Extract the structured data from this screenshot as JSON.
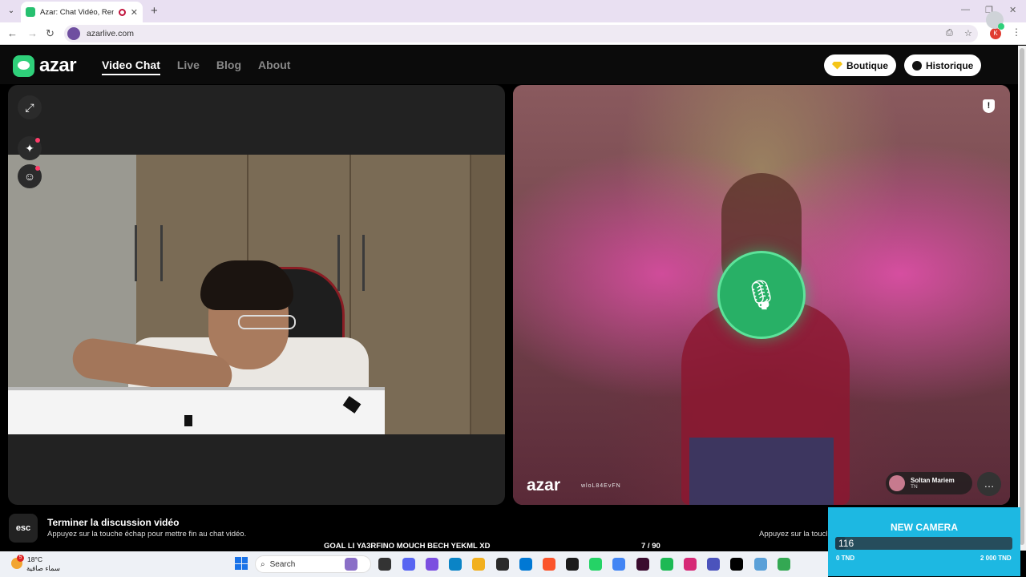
{
  "browser": {
    "tab_title": "Azar: Chat Vidéo, Rencontr",
    "url": "azarlive.com",
    "profile_initial": "K"
  },
  "azar": {
    "logo": "azar",
    "nav": [
      "Video Chat",
      "Live",
      "Blog",
      "About"
    ],
    "boutique": "Boutique",
    "historique": "Historique"
  },
  "remote": {
    "watermark": "azar",
    "watermark_id": "wloL84EvFN",
    "partner_name": "Soltan Mariem",
    "partner_country": "TN"
  },
  "bottom": {
    "esc_key": "esc",
    "esc_title": "Terminer la discussion vidéo",
    "esc_desc": "Appuyez sur la touche échap pour mettre fin au chat vidéo.",
    "esc_desc_right": "Appuyez sur la touch"
  },
  "goal": {
    "text": "GOAL LI YA3RFINO MOUCH BECH YEKML XD",
    "count": "7   / 90",
    "current": 7,
    "target": 90
  },
  "new_camera": {
    "title": "NEW CAMERA",
    "value": "116",
    "min_label": "0 TND",
    "max_label": "2 000 TND",
    "fraction": 0.058
  },
  "taskbar": {
    "temp": "18°C",
    "weather_desc": "سماء صافية",
    "weather_badge": "5",
    "search_label": "Search"
  },
  "colors": {
    "accent_green": "#28b066",
    "widget_blue": "#1db8e2",
    "tab_bg": "#e9e0f2"
  }
}
